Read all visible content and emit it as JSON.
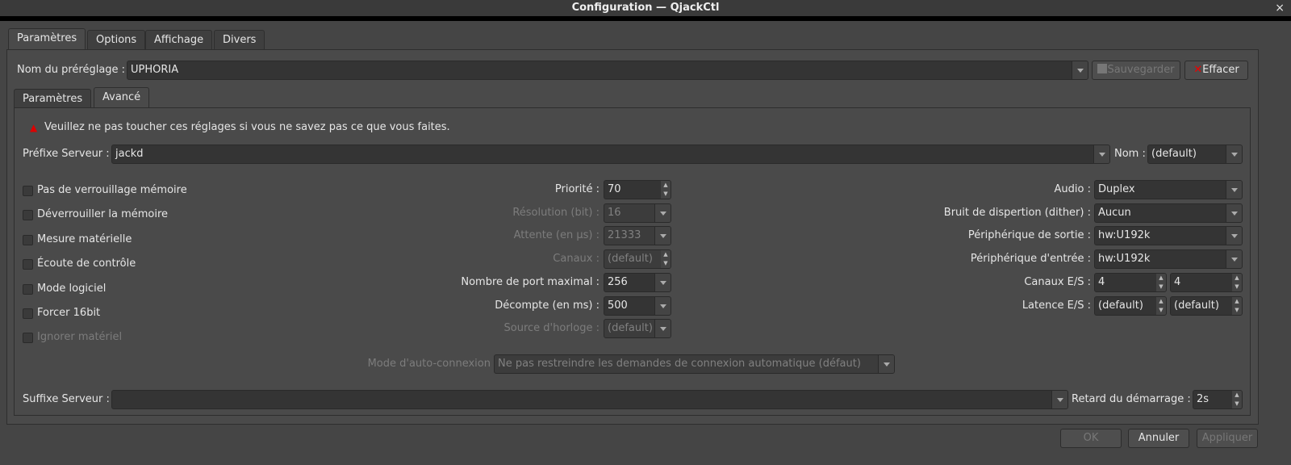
{
  "window": {
    "title": "Configuration — QjackCtl",
    "close": "×"
  },
  "tabs": [
    "Paramètres",
    "Options",
    "Affichage",
    "Divers"
  ],
  "preset": {
    "label": "Nom du préréglage :",
    "value": "UPHORIA",
    "save": "Sauvegarder",
    "delete": "Effacer"
  },
  "subtabs": [
    "Paramètres",
    "Avancé"
  ],
  "warning": "Veuillez ne pas toucher ces réglages si vous ne savez pas ce que vous faites.",
  "prefix": {
    "label": "Préfixe Serveur :",
    "value": "jackd",
    "name_label": "Nom :",
    "name_value": "(default)"
  },
  "checkboxes": [
    {
      "label": "Pas de verrouillage mémoire",
      "checked": false,
      "enabled": true
    },
    {
      "label": "Déverrouiller la mémoire",
      "checked": false,
      "enabled": true
    },
    {
      "label": "Mesure matérielle",
      "checked": false,
      "enabled": true
    },
    {
      "label": "Écoute de contrôle",
      "checked": false,
      "enabled": true
    },
    {
      "label": "Mode logiciel",
      "checked": false,
      "enabled": true
    },
    {
      "label": "Forcer 16bit",
      "checked": false,
      "enabled": true
    },
    {
      "label": "Ignorer matériel",
      "checked": false,
      "enabled": false
    }
  ],
  "middle": [
    {
      "label": "Priorité :",
      "value": "70"
    },
    {
      "label": "Résolution (bit) :",
      "value": "16"
    },
    {
      "label": "Attente (en µs) :",
      "value": "21333"
    },
    {
      "label": "Canaux :",
      "value": "(default)"
    },
    {
      "label": "Nombre de port maximal :",
      "value": "256"
    },
    {
      "label": "Décompte (en ms) :",
      "value": "500"
    },
    {
      "label": "Source d'horloge :",
      "value": "(default)"
    }
  ],
  "right": [
    {
      "label": "Audio :",
      "value": "Duplex"
    },
    {
      "label": "Bruit de dispertion (dither) :",
      "value": "Aucun"
    },
    {
      "label": "Périphérique de sortie :",
      "value": "hw:U192k"
    },
    {
      "label": "Périphérique d'entrée :",
      "value": "hw:U192k"
    },
    {
      "label": "Canaux E/S :",
      "value_in": "4",
      "value_out": "4"
    },
    {
      "label": "Latence E/S :",
      "value_in": "(default)",
      "value_out": "(default)"
    }
  ],
  "autoconnect": {
    "label": "Mode d'auto-connexion",
    "value": "Ne pas restreindre les demandes de connexion automatique (défaut)"
  },
  "suffix": {
    "label": "Suffixe Serveur :",
    "value": "",
    "delay_label": "Retard du démarrage :",
    "delay_value": "2s"
  },
  "buttons": {
    "ok": "OK",
    "cancel": "Annuler",
    "apply": "Appliquer"
  }
}
